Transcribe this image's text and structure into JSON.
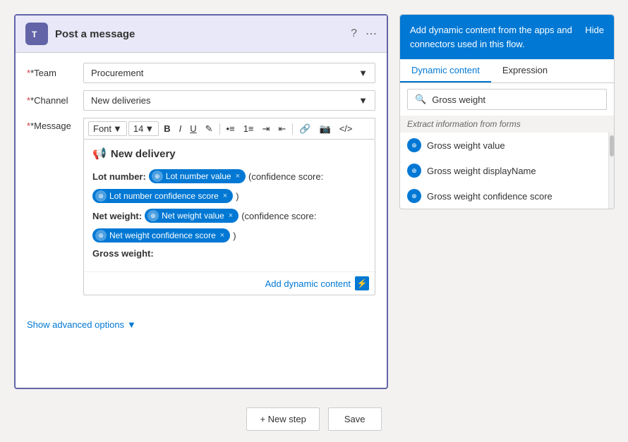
{
  "card": {
    "title": "Post a message",
    "team_label": "*Team",
    "team_value": "Procurement",
    "channel_label": "*Channel",
    "channel_value": "New deliveries",
    "message_label": "*Message",
    "font_label": "Font",
    "font_size": "14",
    "toolbar_buttons": [
      "B",
      "I",
      "U"
    ],
    "new_delivery_title": "New delivery",
    "lot_number_label": "Lot number:",
    "lot_number_tag": "Lot number value",
    "confidence_label": "(confidence score:",
    "lot_confidence_tag": "Lot number confidence score",
    "net_weight_label": "Net weight:",
    "net_weight_tag": "Net weight value",
    "net_confidence_tag": "Net weight confidence score",
    "gross_weight_label": "Gross weight:",
    "add_dynamic_label": "Add dynamic content",
    "show_advanced_label": "Show advanced options"
  },
  "bottom": {
    "new_step_label": "+ New step",
    "save_label": "Save"
  },
  "dynamic_panel": {
    "header_text": "Add dynamic content from the apps and connectors used in this flow.",
    "hide_label": "Hide",
    "tab_dynamic": "Dynamic content",
    "tab_expression": "Expression",
    "search_placeholder": "Gross weight",
    "section_label": "Extract information from forms",
    "items": [
      {
        "label": "Gross weight value"
      },
      {
        "label": "Gross weight displayName"
      },
      {
        "label": "Gross weight confidence score"
      }
    ]
  }
}
